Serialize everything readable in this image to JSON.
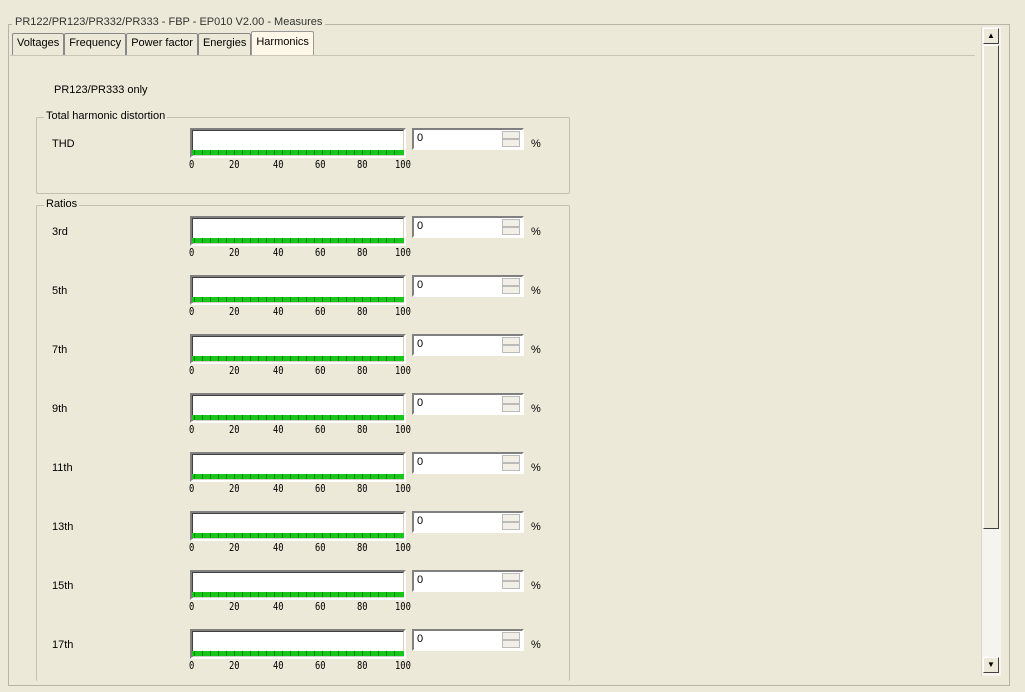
{
  "window": {
    "title": "PR122/PR123/PR332/PR333 - FBP - EP010 V2.00 - Measures"
  },
  "tabs": [
    {
      "label": "Voltages",
      "active": false
    },
    {
      "label": "Frequency",
      "active": false
    },
    {
      "label": "Power factor",
      "active": false
    },
    {
      "label": "Energies",
      "active": false
    },
    {
      "label": "Harmonics",
      "active": true
    }
  ],
  "note": "PR123/PR333 only",
  "axis_ticks": [
    "0",
    "20",
    "40",
    "60",
    "80",
    "100"
  ],
  "unit": "%",
  "thd": {
    "group_label": "Total harmonic distortion",
    "label": "THD",
    "value": "0",
    "level_percent": 0
  },
  "ratios": {
    "group_label": "Ratios",
    "rows": [
      {
        "label": "3rd",
        "value": "0",
        "level_percent": 0
      },
      {
        "label": "5th",
        "value": "0",
        "level_percent": 0
      },
      {
        "label": "7th",
        "value": "0",
        "level_percent": 0
      },
      {
        "label": "9th",
        "value": "0",
        "level_percent": 0
      },
      {
        "label": "11th",
        "value": "0",
        "level_percent": 0
      },
      {
        "label": "13th",
        "value": "0",
        "level_percent": 0
      },
      {
        "label": "15th",
        "value": "0",
        "level_percent": 0
      },
      {
        "label": "17th",
        "value": "0",
        "level_percent": 0
      }
    ]
  },
  "scrollbar": {
    "up_icon": "arrow-up-icon",
    "down_icon": "arrow-down-icon"
  },
  "colors": {
    "bar_scale": "#18c818"
  }
}
